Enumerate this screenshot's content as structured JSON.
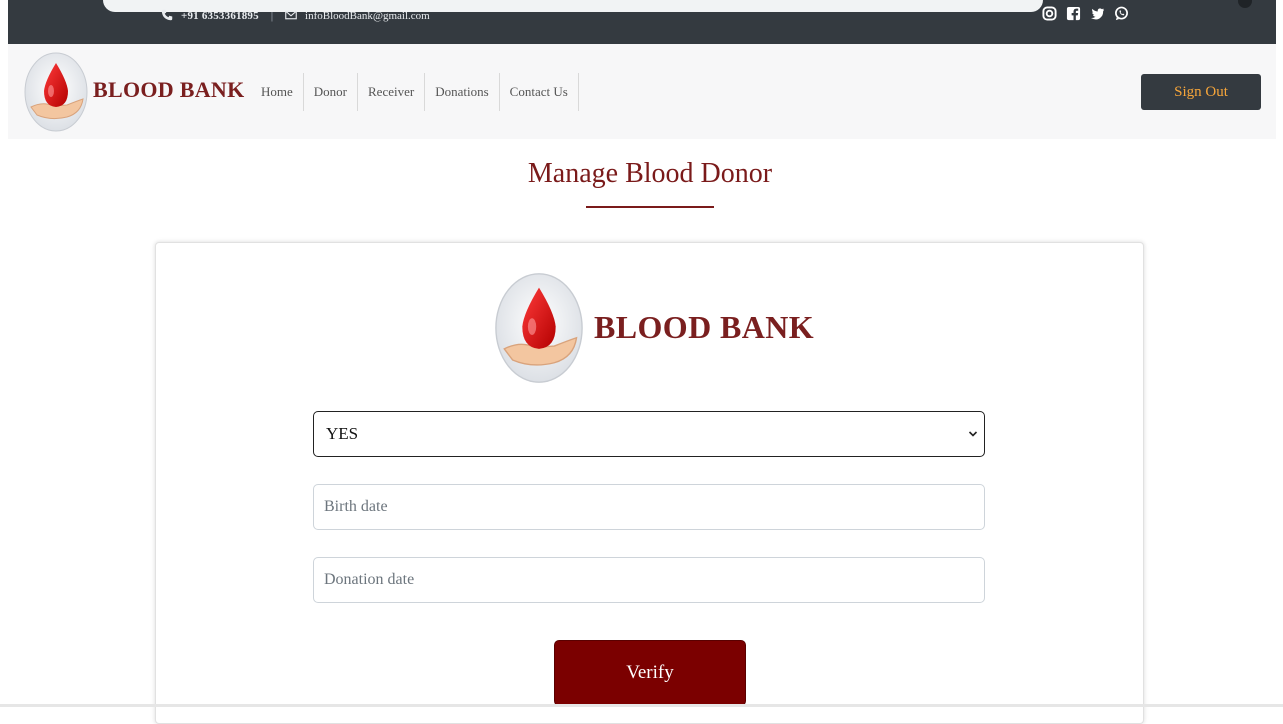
{
  "topbar": {
    "phone": "+91 6353361895",
    "email": "infoBloodBank@gmail.com",
    "social_icons": [
      "instagram-icon",
      "facebook-icon",
      "twitter-icon",
      "whatsapp-icon"
    ]
  },
  "navbar": {
    "brand": "BLOOD BANK",
    "links": [
      "Home",
      "Donor",
      "Receiver",
      "Donations",
      "Contact Us"
    ],
    "signout_label": "Sign Out"
  },
  "page": {
    "title": "Manage Blood Donor"
  },
  "form": {
    "brand": "BLOOD BANK",
    "select_value": "YES",
    "birth_placeholder": "Birth date",
    "donation_placeholder": "Donation date",
    "verify_label": "Verify"
  },
  "colors": {
    "brand_red": "#7a1f1f",
    "button_red": "#7b0000",
    "dark_bar": "#343a40",
    "signout_text": "#f7a63a"
  }
}
